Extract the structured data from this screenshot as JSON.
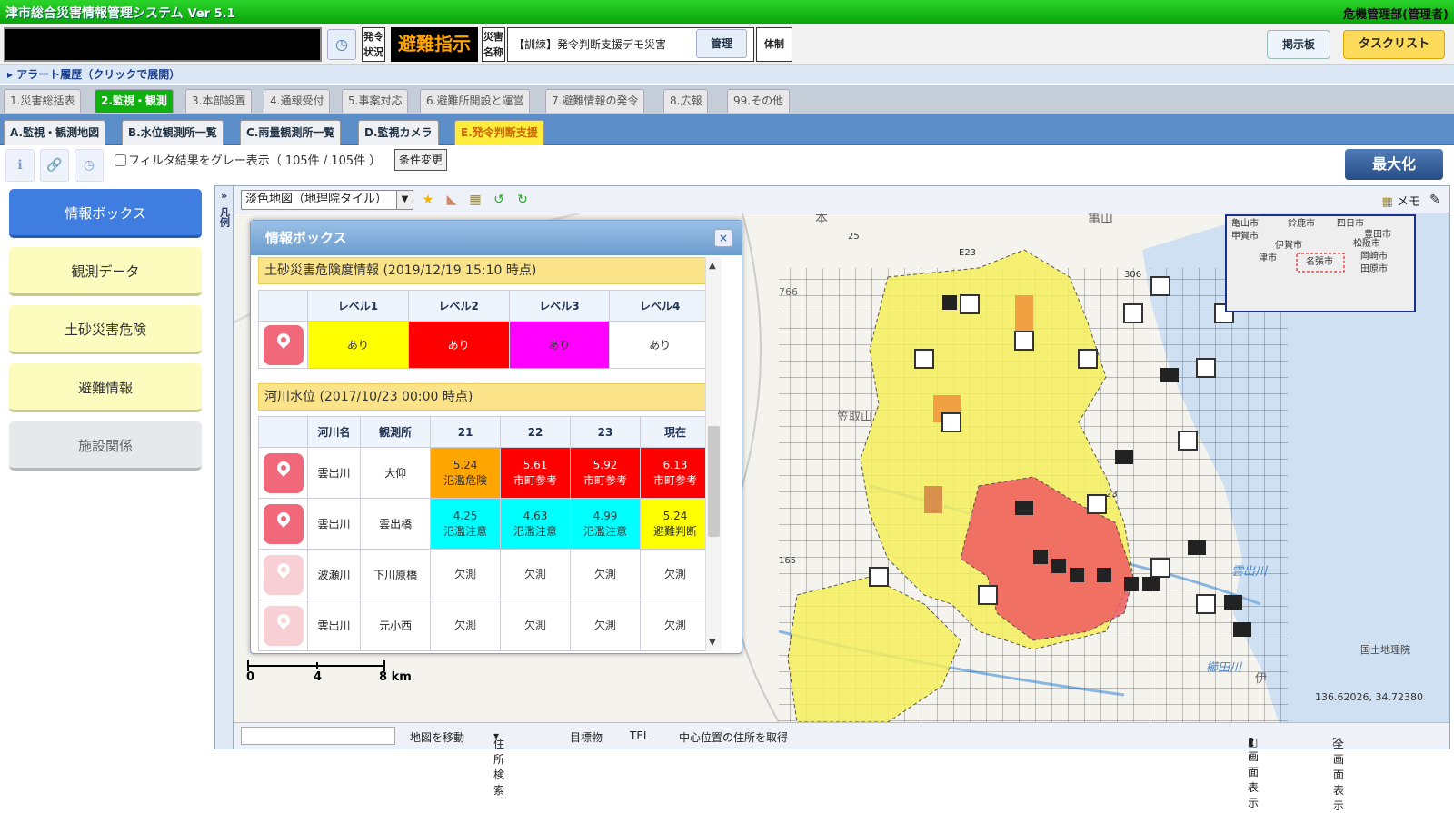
{
  "app": {
    "title": "津市総合災害情報管理システム",
    "version": "Ver 5.1",
    "user": "危機管理部(管理者)"
  },
  "status": {
    "hatsurei_label": "発令状況",
    "hatsurei_value": "避難指示",
    "saigai_label": "災害名称",
    "saigai_value": "【訓練】発令判断支援デモ災害",
    "kanri_label": "管理",
    "taisei_label": "体制",
    "bbs_label": "掲示板",
    "tasklist_label": "タスクリスト"
  },
  "alert": {
    "label": "アラート履歴（クリックで展開）"
  },
  "tabs1": [
    "1.災害総括表",
    "2.監視・観測",
    "3.本部設置",
    "4.通報受付",
    "5.事案対応",
    "6.避難所開設と運営",
    "7.避難情報の発令",
    "8.広報",
    "99.その他"
  ],
  "tabs2": [
    "A.監視・観測地図",
    "B.水位観測所一覧",
    "C.雨量観測所一覧",
    "D.監視カメラ",
    "E.発令判断支援"
  ],
  "toolbar": {
    "filter_label": "フィルタ結果をグレー表示（ 105件 / 105件 ）",
    "cond_label": "条件変更",
    "max_label": "最大化"
  },
  "left": [
    "情報ボックス",
    "観測データ",
    "土砂災害危険",
    "避難情報",
    "施設関係"
  ],
  "map": {
    "legend": "凡例",
    "layer": "淡色地図（地理院タイル）",
    "memo": "メモ",
    "attribution": "国土地理院",
    "coords": "136.62026, 34.72380",
    "scale": [
      "0",
      "4",
      "8 km"
    ],
    "bottom": {
      "move": "地図を移動",
      "addr": "住所検索",
      "landmark": "目標物",
      "tel": "TEL",
      "center": "中心位置の住所を取得",
      "two": "2画面表示",
      "full": "全画面表示"
    },
    "labels": [
      "本",
      "亀山",
      "笠取山",
      "伊",
      "雲出川",
      "櫛田川",
      "766",
      "25",
      "E23",
      "306",
      "165",
      "23"
    ],
    "overview": [
      "亀山市",
      "鈴鹿市",
      "甲賀市",
      "伊賀市",
      "名張市",
      "四日市",
      "津市",
      "松阪市",
      "田原市",
      "豊田市",
      "岡崎市"
    ]
  },
  "infobox": {
    "title": "情報ボックス",
    "dosha": {
      "header": "土砂災害危険度情報 (2019/12/19 15:10 時点)",
      "cols": [
        "レベル1",
        "レベル2",
        "レベル3",
        "レベル4"
      ],
      "vals": [
        "あり",
        "あり",
        "あり",
        "あり"
      ],
      "colors": [
        "#ffff00",
        "#ff0000",
        "#ff00ff",
        "#ffffff"
      ]
    },
    "river": {
      "header": "河川水位 (2017/10/23 00:00 時点)",
      "cols": [
        "河川名",
        "観測所",
        "21",
        "22",
        "23",
        "現在"
      ],
      "rows": [
        {
          "river": "雲出川",
          "station": "大仰",
          "cells": [
            [
              "5.24",
              "氾濫危険"
            ],
            [
              "5.61",
              "市町参考"
            ],
            [
              "5.92",
              "市町参考"
            ],
            [
              "6.13",
              "市町参考"
            ]
          ],
          "colors": [
            "#ffa500",
            "#ff0000",
            "#ff0000",
            "#ff0000"
          ],
          "light": false
        },
        {
          "river": "雲出川",
          "station": "雲出橋",
          "cells": [
            [
              "4.25",
              "氾濫注意"
            ],
            [
              "4.63",
              "氾濫注意"
            ],
            [
              "4.99",
              "氾濫注意"
            ],
            [
              "5.24",
              "避難判断"
            ]
          ],
          "colors": [
            "#00ffff",
            "#00ffff",
            "#00ffff",
            "#ffff00"
          ],
          "light": false
        },
        {
          "river": "波瀬川",
          "station": "下川原橋",
          "cells": [
            [
              "欠測",
              ""
            ],
            [
              "欠測",
              ""
            ],
            [
              "欠測",
              ""
            ],
            [
              "欠測",
              ""
            ]
          ],
          "colors": [
            "#fff",
            "#fff",
            "#fff",
            "#fff"
          ],
          "light": true
        },
        {
          "river": "雲出川",
          "station": "元小西",
          "cells": [
            [
              "欠測",
              ""
            ],
            [
              "欠測",
              ""
            ],
            [
              "欠測",
              ""
            ],
            [
              "欠測",
              ""
            ]
          ],
          "colors": [
            "#fff",
            "#fff",
            "#fff",
            "#fff"
          ],
          "light": true
        }
      ]
    }
  }
}
